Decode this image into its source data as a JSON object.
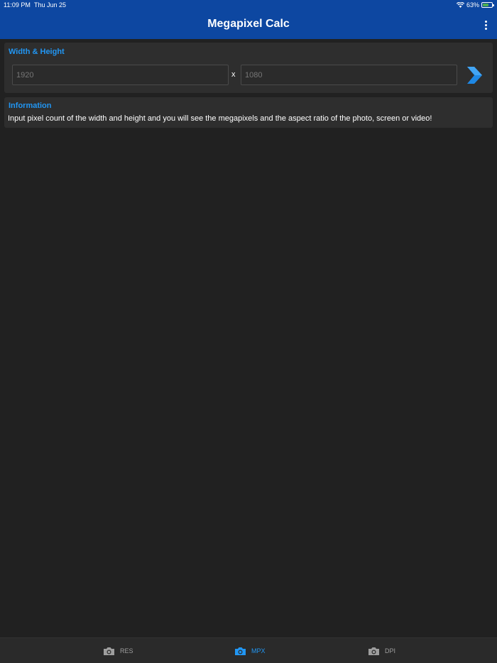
{
  "status": {
    "time": "11:09 PM",
    "date": "Thu Jun 25",
    "battery": "63%",
    "battery_level": 0.63
  },
  "app": {
    "title": "Megapixel Calc",
    "menu_icon": "more-vertical-icon"
  },
  "dimensions": {
    "title": "Width & Height",
    "width_value": "",
    "width_placeholder": "1920",
    "separator": "x",
    "height_value": "",
    "height_placeholder": "1080",
    "go_icon": "chevron-right-icon"
  },
  "information": {
    "title": "Information",
    "text": "Input pixel count of the width and height and you will see the megapixels and the aspect ratio of the photo, screen or video!"
  },
  "tabs": [
    {
      "label": "RES",
      "icon": "camera-icon",
      "active": false
    },
    {
      "label": "MPX",
      "icon": "camera-icon",
      "active": true
    },
    {
      "label": "DPI",
      "icon": "camera-icon",
      "active": false
    }
  ],
  "colors": {
    "app_bar": "#0d47a1",
    "accent": "#2196f3",
    "background": "#212121",
    "card": "#2e2e2e"
  }
}
